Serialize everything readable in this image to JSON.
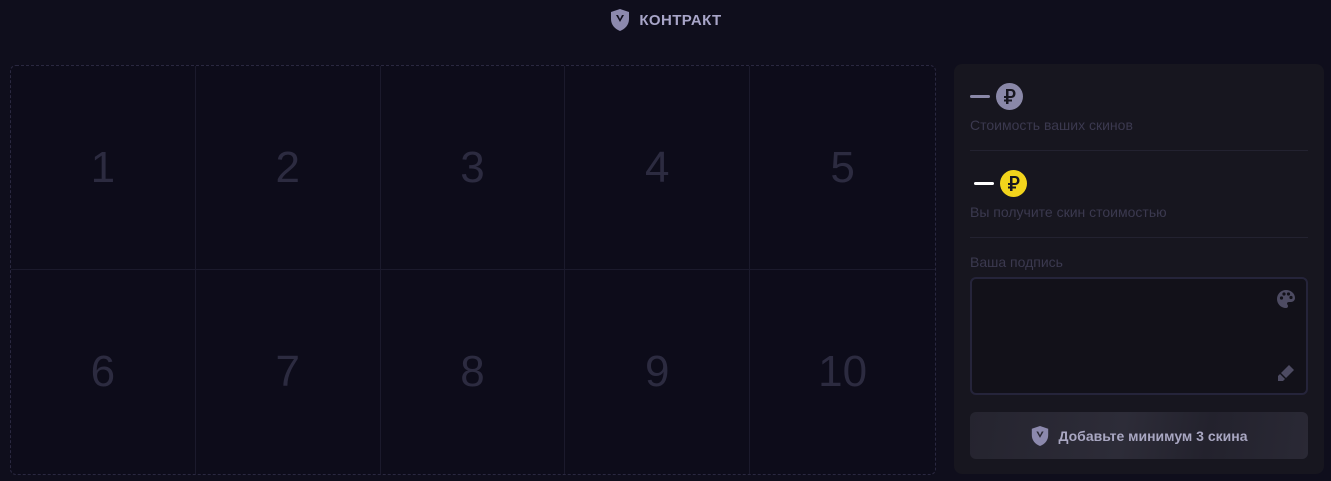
{
  "header": {
    "title": "КОНТРАКТ",
    "icon": "shield-icon"
  },
  "slots": [
    "1",
    "2",
    "3",
    "4",
    "5",
    "6",
    "7",
    "8",
    "9",
    "10"
  ],
  "panel": {
    "your_skins_value": "—",
    "your_skins_caption": "Стоимость ваших скинов",
    "receive_value": "—",
    "receive_caption": "Вы получите скин стоимостью",
    "signature_label": "Ваша подпись",
    "submit_label": "Добавьте минимум 3 скина"
  },
  "colors": {
    "background": "#0f0e1c",
    "panel": "#17161f",
    "coin_gray": "#8a88a8",
    "coin_gold": "#f2d41c",
    "slot_number": "#2c2b40"
  },
  "icons": [
    "shield-icon",
    "ruble-coin-icon",
    "ruble-gold-coin-icon",
    "palette-icon",
    "eraser-icon"
  ]
}
